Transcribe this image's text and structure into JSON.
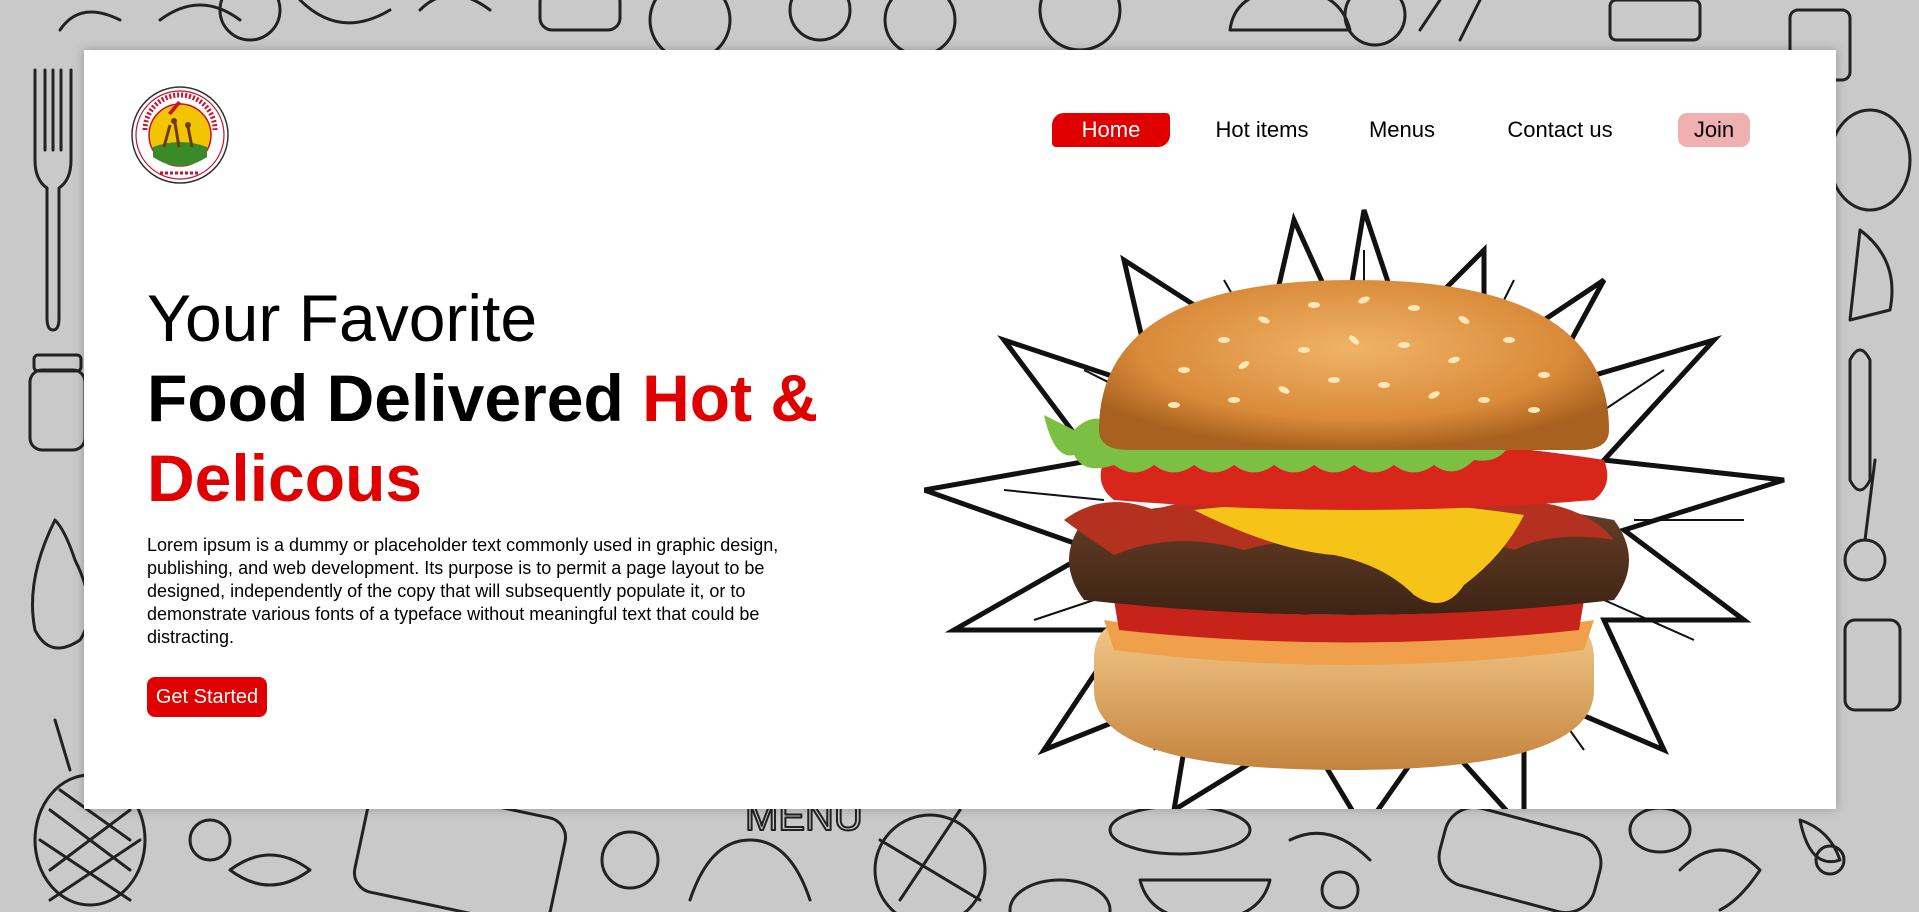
{
  "logo": {
    "ring_text": "ARELLANO UNIVERSITY",
    "bottom_text": "MANILA 1938",
    "colors": {
      "ring": "#c8102e",
      "center": "#f2c500"
    }
  },
  "nav": {
    "items": [
      {
        "label": "Home",
        "active": true
      },
      {
        "label": "Hot items",
        "active": false
      },
      {
        "label": "Menus",
        "active": false
      },
      {
        "label": "Contact us",
        "active": false
      },
      {
        "label": "Join",
        "active": false
      }
    ]
  },
  "hero": {
    "title_line1": "Your Favorite",
    "title_line2_dark": "Food Delivered",
    "title_line2_red": "Hot & Delicous",
    "description": "Lorem ipsum is a dummy or placeholder text commonly used in graphic design, publishing, and web development. Its purpose is to permit a page layout to be designed, independently of the copy that will subsequently populate it, or to demonstrate various fonts of a typeface without meaningful text that could be distracting.",
    "cta_label": "Get Started",
    "image_icon": "burger-with-burst-icon"
  },
  "colors": {
    "accent": "#e00000",
    "join_bg": "#f0b0b0",
    "page_bg": "#c9c9c9",
    "card_bg": "#ffffff"
  }
}
